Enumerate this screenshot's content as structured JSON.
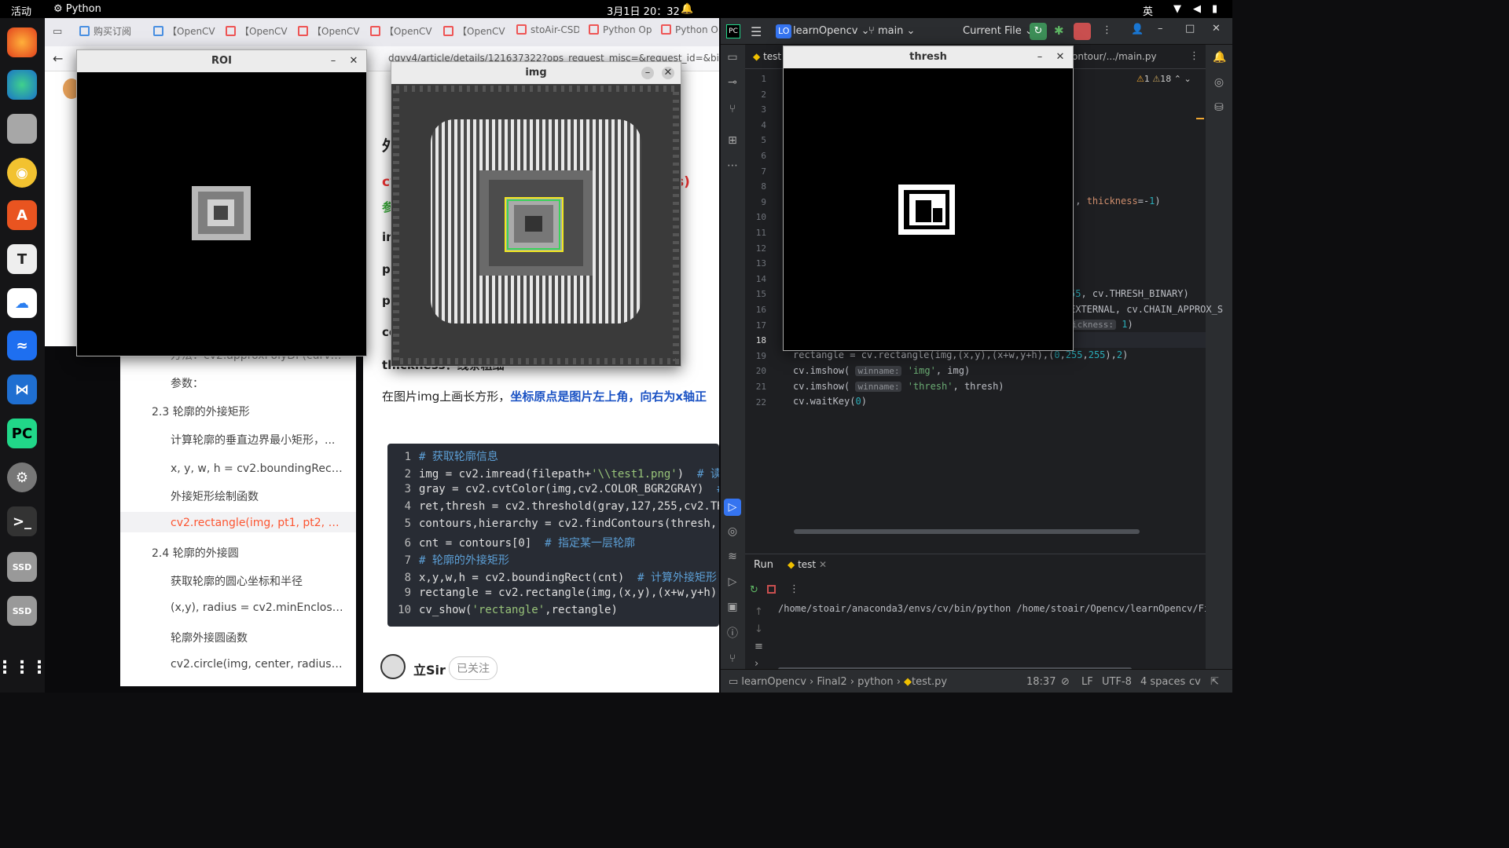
{
  "topbar": {
    "activities": "活动",
    "app_name": "Python",
    "clock": "3月1日 20：32",
    "lang": "英"
  },
  "browser": {
    "tabs": [
      "购买订阅",
      "【OpenCV",
      "【OpenCV",
      "【OpenCV",
      "【OpenCV",
      "【OpenCV",
      "stoAir-CSD",
      "Python Op",
      "Python Op"
    ],
    "url": "dgvv4/article/details/121637322?ops_request_misc=&request_id=&biz_id=102",
    "nav_text": "ode"
  },
  "toc": {
    "items": [
      {
        "label": "方法：cv2.approxPolyDP(curve,...",
        "level": 2
      },
      {
        "label": "参数：",
        "level": 2
      },
      {
        "label": "2.3 轮廓的外接矩形",
        "level": 1
      },
      {
        "label": "计算轮廓的垂直边界最小矩形，...",
        "level": 2
      },
      {
        "label": "x, y, w, h = cv2.boundingRect(轮...",
        "level": 2
      },
      {
        "label": "外接矩形绘制函数",
        "level": 2
      },
      {
        "label": "cv2.rectangle(img, pt1, pt2, color...",
        "level": 2,
        "active": true
      },
      {
        "label": "2.4 轮廓的外接圆",
        "level": 1
      },
      {
        "label": "获取轮廓的圆心坐标和半径",
        "level": 2
      },
      {
        "label": "(x,y), radius = cv2.minEnclosing...",
        "level": 2
      },
      {
        "label": "轮廓外接圆函数",
        "level": 2
      },
      {
        "label": "cv2.circle(img, center, radius, col...",
        "level": 2
      }
    ]
  },
  "article": {
    "heading_fragment": "外",
    "red_fragment": "cv",
    "red_tail": "s)",
    "green_fragment": "参",
    "lines": [
      "im",
      "pt",
      "pt",
      "co"
    ],
    "thickness_text": "thickness：线条粗细",
    "desc_plain": "在图片img上画长方形，",
    "desc_bold": "坐标原点是图片左上角，向右为x轴正",
    "code": [
      {
        "n": "1",
        "parts": [
          {
            "t": "# 获取轮廓信息",
            "c": "cm"
          }
        ]
      },
      {
        "n": "2",
        "parts": [
          {
            "t": "img = cv2.imread(filepath+",
            "c": ""
          },
          {
            "t": "'\\\\test1.png'",
            "c": "st"
          },
          {
            "t": ")  ",
            "c": ""
          },
          {
            "t": "# 读",
            "c": "cm"
          }
        ]
      },
      {
        "n": "3",
        "parts": [
          {
            "t": "gray = cv2.cvtColor(img,cv2.COLOR_BGR2GRAY)  ",
            "c": ""
          },
          {
            "t": "#",
            "c": "cm"
          }
        ]
      },
      {
        "n": "4",
        "parts": [
          {
            "t": "ret,thresh = cv2.threshold(gray,127,255,cv2.TH",
            "c": ""
          }
        ]
      },
      {
        "n": "5",
        "parts": [
          {
            "t": "contours,hierarchy = cv2.findContours(thresh,",
            "c": ""
          }
        ]
      },
      {
        "n": "6",
        "parts": [
          {
            "t": "cnt = contours[0]  ",
            "c": ""
          },
          {
            "t": "# 指定某一层轮廓",
            "c": "cm"
          }
        ]
      },
      {
        "n": "7",
        "parts": [
          {
            "t": "# 轮廓的外接矩形",
            "c": "cm"
          }
        ]
      },
      {
        "n": "8",
        "parts": [
          {
            "t": "x,y,w,h = cv2.boundingRect(cnt)  ",
            "c": ""
          },
          {
            "t": "# 计算外接矩形",
            "c": "cm"
          }
        ]
      },
      {
        "n": "9",
        "parts": [
          {
            "t": "rectangle = cv2.rectangle(img,(x,y),(x+w,y+h)",
            "c": ""
          }
        ]
      },
      {
        "n": "10",
        "parts": [
          {
            "t": "cv_show(",
            "c": ""
          },
          {
            "t": "'rectangle'",
            "c": "st"
          },
          {
            "t": ",rectangle)",
            "c": ""
          }
        ]
      }
    ],
    "author": "立Sir",
    "follow_label": "已关注"
  },
  "windows": {
    "roi": {
      "title": "ROI"
    },
    "img": {
      "title": "img"
    },
    "thresh": {
      "title": "thresh"
    }
  },
  "ide": {
    "project_badge": "LO",
    "project": "learnOpencv",
    "branch": "main",
    "run_config": "Current File",
    "tab_file": "test",
    "breadcrumb_path": "ontour/.../main.py",
    "warnings": "1",
    "weak_warnings": "18",
    "line_numbers": [
      "1",
      "2",
      "3",
      "4",
      "5",
      "6",
      "7",
      "8",
      "9",
      "10",
      "11",
      "12",
      "13",
      "14",
      "15",
      "16",
      "17",
      "18",
      "19",
      "20",
      "21",
      "22"
    ],
    "run_tab_label": "Run",
    "run_file": "test",
    "console": "/home/stoair/anaconda3/envs/cv/bin/python /home/stoair/Opencv/learnOpencv/Final2/py",
    "status": {
      "crumbs": [
        "learnOpencv",
        "Final2",
        "python",
        "test.py"
      ],
      "position": "18:37",
      "line_sep": "LF",
      "encoding": "UTF-8",
      "indent": "4 spaces",
      "interpreter": "cv"
    }
  }
}
